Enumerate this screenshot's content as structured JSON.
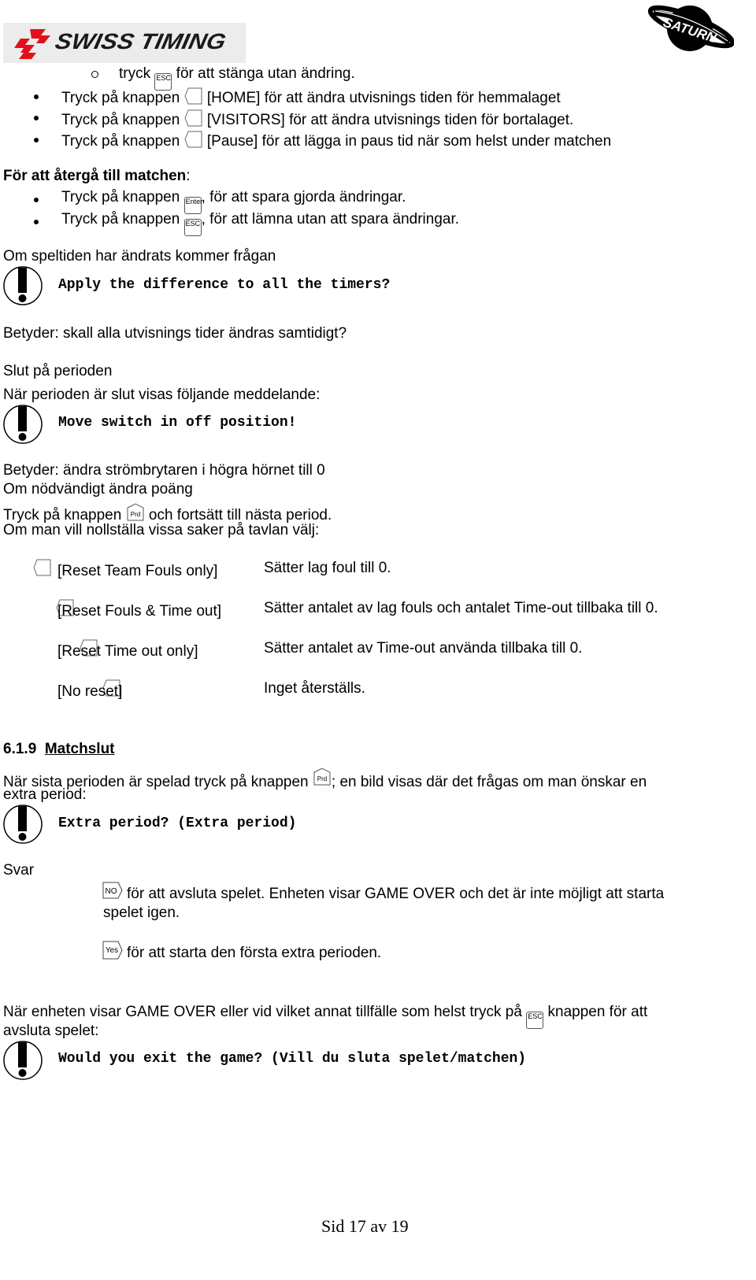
{
  "header": {
    "left_logo": "SWISS TIMING",
    "right_logo": "SATURN"
  },
  "top_list": {
    "sub_item": {
      "prefix": "tryck",
      "key": "ESC",
      "suffix": "för att stänga utan ändring."
    },
    "items": [
      {
        "prefix": "Tryck på knappen",
        "key": "",
        "suffix": "[HOME] för att ändra utvisnings tiden för hemmalaget"
      },
      {
        "prefix": "Tryck på knappen",
        "key": "",
        "suffix": "[VISITORS] för att ändra utvisnings tiden för bortalaget."
      },
      {
        "prefix": "Tryck på knappen",
        "key": "",
        "suffix": "[Pause] för att lägga in paus tid när som helst under matchen"
      }
    ]
  },
  "return_section": {
    "heading_bold": "För att återgå till matchen",
    "heading_colon": ":",
    "items": [
      {
        "prefix": "Tryck på knappen",
        "key": "Enter",
        "suffix": ", för att spara gjorda ändringar."
      },
      {
        "prefix": "Tryck på knappen",
        "key": "ESC",
        "suffix": ", för att lämna utan att spara ändringar."
      }
    ]
  },
  "gametime_changed": {
    "intro": "Om speltiden har ändrats kommer frågan",
    "message": "Apply the difference to all the timers?",
    "meaning": "Betyder: skall alla utvisnings tider ändras samtidigt?"
  },
  "end_of_period": {
    "title": "Slut på perioden",
    "intro": "När perioden är slut visas följande meddelande:",
    "message": "Move switch in off position!",
    "meaning": "Betyder: ändra strömbrytaren i högra hörnet till 0",
    "line2": "Om nödvändigt ändra poäng",
    "line3_prefix": "Tryck på knappen",
    "line3_key": "Prd",
    "line3_suffix": "och fortsätt till nästa period.",
    "line4": "Om man vill nollställa vissa saker på tavlan välj:"
  },
  "reset_options": [
    {
      "option": "[Reset Team Fouls only]",
      "description": "Sätter lag foul till 0."
    },
    {
      "option": "[Reset Fouls & Time out]",
      "description": "Sätter antalet av lag fouls och antalet Time-out tillbaka till 0."
    },
    {
      "option": "[Reset Time out only]",
      "description": "Sätter antalet av Time-out använda tillbaka till 0."
    },
    {
      "option": "[No reset]",
      "description": "Inget återställs."
    }
  ],
  "match_end": {
    "section_number": "6.1.9",
    "section_title": "Matchslut",
    "intro_prefix": "När sista perioden är spelad tryck på knappen",
    "intro_key": "Prd",
    "intro_suffix": "; en bild visas där det frågas om man önskar en",
    "intro_line2": "extra period:",
    "message": "Extra period? (Extra period)",
    "answer_label": "Svar",
    "answers": [
      {
        "key": "NO",
        "text_line1": "för att avsluta spelet. Enheten visar GAME OVER och det är inte möjligt att starta",
        "text_line2": "spelet igen."
      },
      {
        "key": "Yes",
        "text_line1": "för att starta den första extra perioden.",
        "text_line2": ""
      }
    ],
    "exit_prefix": "När enheten visar GAME OVER eller vid vilket annat tillfälle som helst tryck på",
    "exit_key": "ESC",
    "exit_suffix": "knappen för att",
    "exit_line2": "avsluta spelet:",
    "exit_message": "Would you exit the game? (Vill du sluta spelet/matchen)"
  },
  "footer": {
    "page_label": "Sid 17 av 19"
  }
}
